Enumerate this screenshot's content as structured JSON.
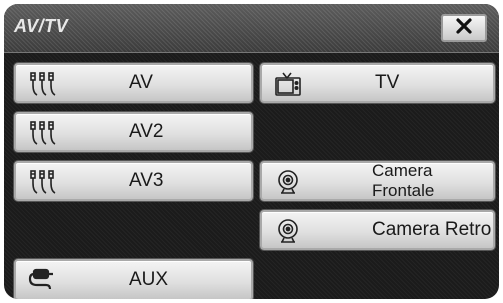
{
  "window": {
    "title": "AV/TV",
    "close_icon": "close-icon"
  },
  "buttons": {
    "av": {
      "label": "AV",
      "icon": "rca-cable-icon"
    },
    "av2": {
      "label": "AV2",
      "icon": "rca-cable-icon"
    },
    "av3": {
      "label": "AV3",
      "icon": "rca-cable-icon"
    },
    "aux": {
      "label": "AUX",
      "icon": "aux-plug-icon"
    },
    "tv": {
      "label": "TV",
      "icon": "tv-icon"
    },
    "camera_front": {
      "label": "Camera Frontale",
      "icon": "camera-icon"
    },
    "camera_rear": {
      "label": "Camera Retro",
      "icon": "camera-icon"
    }
  },
  "colors": {
    "background": "#1b1b1b",
    "button": "#e6e6e6",
    "text": "#1a1a1a"
  }
}
